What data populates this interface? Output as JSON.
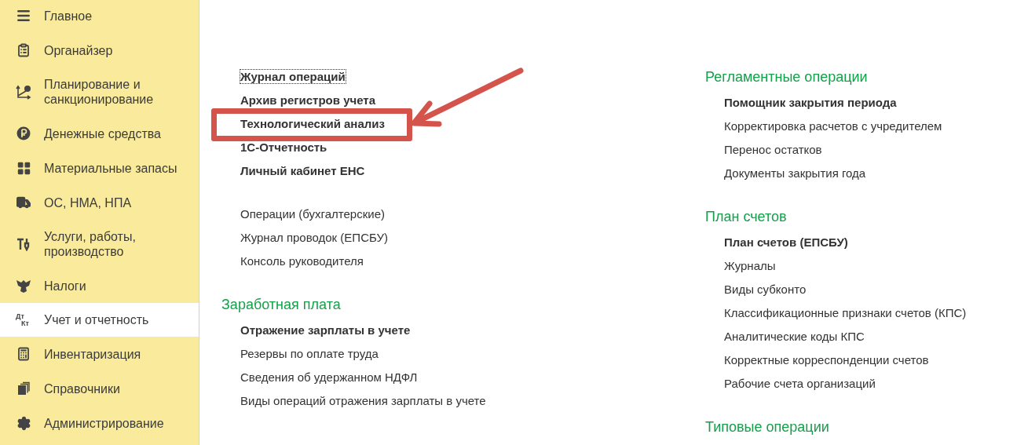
{
  "sidebar": {
    "items": [
      {
        "label": "Главное",
        "kind": "menu",
        "selected": false
      },
      {
        "label": "Органайзер",
        "kind": "clipboard",
        "selected": false
      },
      {
        "label": "Планирование и санкционирование",
        "kind": "axes",
        "selected": false
      },
      {
        "label": "Денежные средства",
        "kind": "ruble",
        "selected": false
      },
      {
        "label": "Материальные запасы",
        "kind": "grid",
        "selected": false
      },
      {
        "label": "ОС, НМА, НПА",
        "kind": "truck",
        "selected": false
      },
      {
        "label": "Услуги, работы, производство",
        "kind": "tools",
        "selected": false
      },
      {
        "label": "Налоги",
        "kind": "emblem",
        "selected": false
      },
      {
        "label": "Учет и отчетность",
        "kind": "letters",
        "icon_text": [
          "Дт",
          "Кт"
        ],
        "selected": true
      },
      {
        "label": "Инвентаризация",
        "kind": "calculator",
        "selected": false
      },
      {
        "label": "Справочники",
        "kind": "stack",
        "selected": false
      },
      {
        "label": "Администрирование",
        "kind": "gear",
        "selected": false
      }
    ]
  },
  "columns": [
    {
      "sections": [
        {
          "items": [
            {
              "label": "Журнал операций",
              "bold": true,
              "focused": true,
              "highlighted": false
            },
            {
              "label": "Архив регистров учета",
              "bold": true,
              "focused": false,
              "highlighted": false
            },
            {
              "label": "Технологический анализ",
              "bold": true,
              "focused": false,
              "highlighted": true
            },
            {
              "label": "1С-Отчетность",
              "bold": true,
              "focused": false,
              "highlighted": false
            },
            {
              "label": "Личный кабинет ЕНС",
              "bold": true,
              "focused": false,
              "highlighted": false
            }
          ]
        },
        {
          "items": [
            {
              "label": "Операции (бухгалтерские)",
              "bold": false,
              "focused": false,
              "highlighted": false
            },
            {
              "label": "Журнал проводок (ЕПСБУ)",
              "bold": false,
              "focused": false,
              "highlighted": false
            },
            {
              "label": "Консоль руководителя",
              "bold": false,
              "focused": false,
              "highlighted": false
            }
          ]
        },
        {
          "title": "Заработная плата",
          "items": [
            {
              "label": "Отражение зарплаты в учете",
              "bold": true,
              "focused": false,
              "highlighted": false
            },
            {
              "label": "Резервы по оплате труда",
              "bold": false,
              "focused": false,
              "highlighted": false
            },
            {
              "label": "Сведения об удержанном НДФЛ",
              "bold": false,
              "focused": false,
              "highlighted": false
            },
            {
              "label": "Виды операций отражения зарплаты в учете",
              "bold": false,
              "focused": false,
              "highlighted": false
            }
          ]
        }
      ]
    },
    {
      "sections": [
        {
          "title": "Регламентные операции",
          "items": [
            {
              "label": "Помощник закрытия периода",
              "bold": true,
              "focused": false,
              "highlighted": false
            },
            {
              "label": "Корректировка расчетов с учредителем",
              "bold": false,
              "focused": false,
              "highlighted": false
            },
            {
              "label": "Перенос остатков",
              "bold": false,
              "focused": false,
              "highlighted": false
            },
            {
              "label": "Документы закрытия года",
              "bold": false,
              "focused": false,
              "highlighted": false
            }
          ]
        },
        {
          "title": "План счетов",
          "items": [
            {
              "label": "План счетов (ЕПСБУ)",
              "bold": true,
              "focused": false,
              "highlighted": false
            },
            {
              "label": "Журналы",
              "bold": false,
              "focused": false,
              "highlighted": false
            },
            {
              "label": "Виды субконто",
              "bold": false,
              "focused": false,
              "highlighted": false
            },
            {
              "label": "Классификационные признаки счетов (КПС)",
              "bold": false,
              "focused": false,
              "highlighted": false
            },
            {
              "label": "Аналитические коды КПС",
              "bold": false,
              "focused": false,
              "highlighted": false
            },
            {
              "label": "Корректные корреспонденции счетов",
              "bold": false,
              "focused": false,
              "highlighted": false
            },
            {
              "label": "Рабочие счета организаций",
              "bold": false,
              "focused": false,
              "highlighted": false
            }
          ]
        },
        {
          "title": "Типовые операции"
        }
      ]
    }
  ]
}
